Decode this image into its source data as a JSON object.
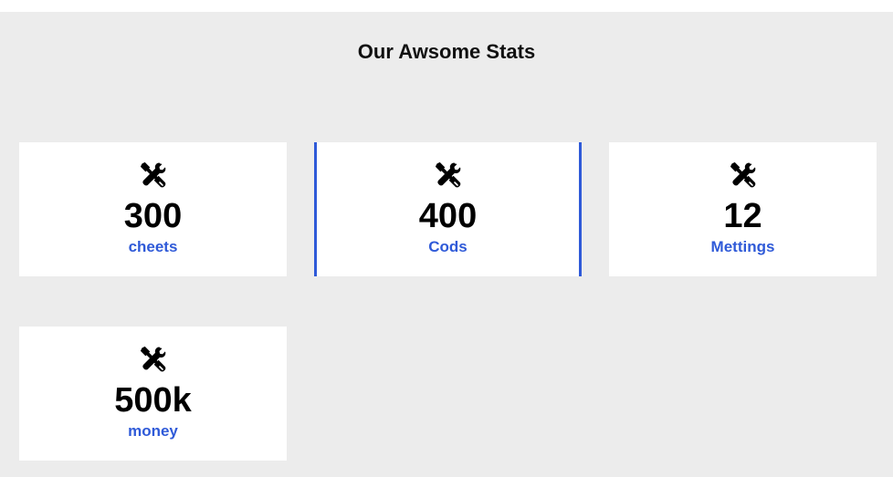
{
  "section": {
    "title": "Our Awsome Stats"
  },
  "stats": [
    {
      "icon": "tools-icon",
      "value": "300",
      "label": "cheets"
    },
    {
      "icon": "tools-icon",
      "value": "400",
      "label": "Cods"
    },
    {
      "icon": "tools-icon",
      "value": "12",
      "label": "Mettings"
    },
    {
      "icon": "tools-icon",
      "value": "500k",
      "label": "money"
    }
  ],
  "colors": {
    "accent": "#2f5ad8",
    "background": "#ececec",
    "card": "#ffffff",
    "text": "#000000"
  }
}
